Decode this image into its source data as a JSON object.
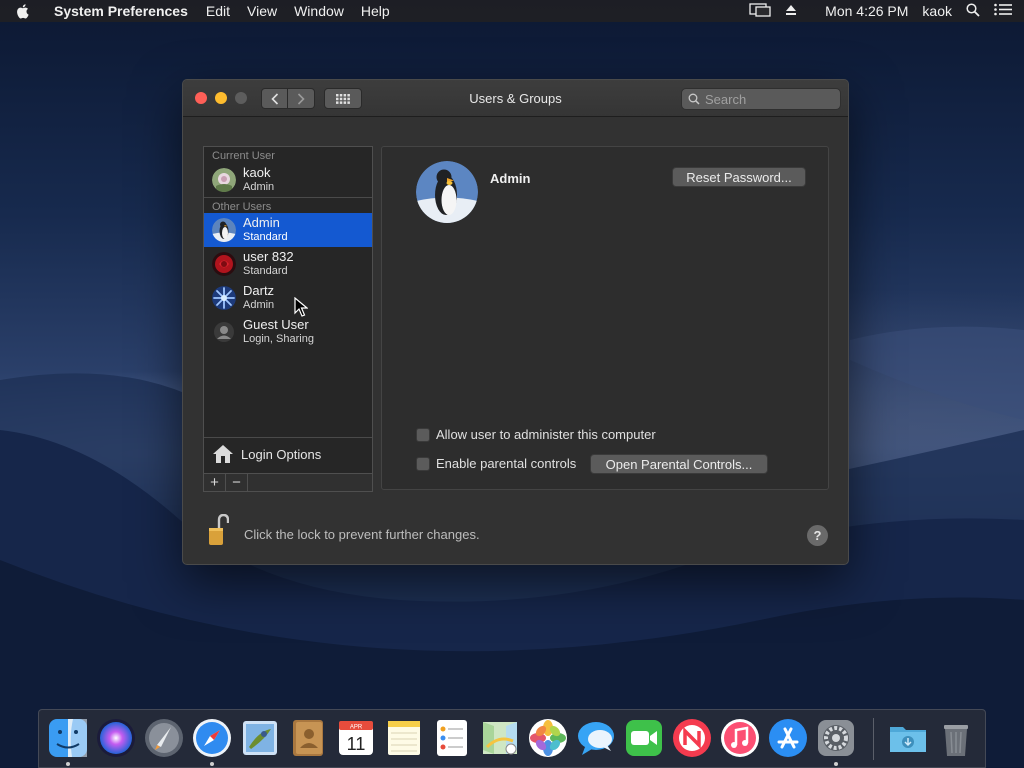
{
  "menubar": {
    "app_name": "System Preferences",
    "items": [
      "Edit",
      "View",
      "Window",
      "Help"
    ],
    "clock": "Mon 4:26 PM",
    "user": "kaok"
  },
  "window": {
    "title": "Users & Groups",
    "search_placeholder": "Search"
  },
  "sidebar": {
    "current_user_label": "Current User",
    "current_user": {
      "name": "kaok",
      "role": "Admin"
    },
    "other_users_label": "Other Users",
    "other_users": [
      {
        "name": "Admin",
        "role": "Standard",
        "selected": true
      },
      {
        "name": "user 832",
        "role": "Standard"
      },
      {
        "name": "Dartz",
        "role": "Admin"
      },
      {
        "name": "Guest User",
        "role": "Login, Sharing"
      }
    ],
    "login_options": "Login Options",
    "add_label": "+",
    "remove_label": "−"
  },
  "detail": {
    "user_name": "Admin",
    "reset_password_label": "Reset Password...",
    "allow_admin_label": "Allow user to administer this computer",
    "parental_controls_label": "Enable parental controls",
    "open_parental_label": "Open Parental Controls...",
    "allow_admin_checked": false,
    "parental_checked": false
  },
  "footer": {
    "lock_text": "Click the lock to prevent further changes.",
    "help_label": "?"
  },
  "dock": {
    "apps": [
      "finder-icon",
      "siri-icon",
      "launchpad-icon",
      "safari-icon",
      "mail-icon",
      "contacts-icon",
      "calendar-icon",
      "notes-icon",
      "reminders-icon",
      "maps-icon",
      "photos-icon",
      "messages-icon",
      "facetime-icon",
      "news-icon",
      "music-icon",
      "app-store-icon",
      "system-preferences-icon",
      "downloads-folder-icon",
      "trash-icon"
    ],
    "calendar_month": "APR",
    "calendar_day": "11"
  },
  "colors": {
    "selection": "#1459d1",
    "window_bg": "#323232",
    "close": "#fe5f57",
    "minimize": "#febc2e"
  }
}
